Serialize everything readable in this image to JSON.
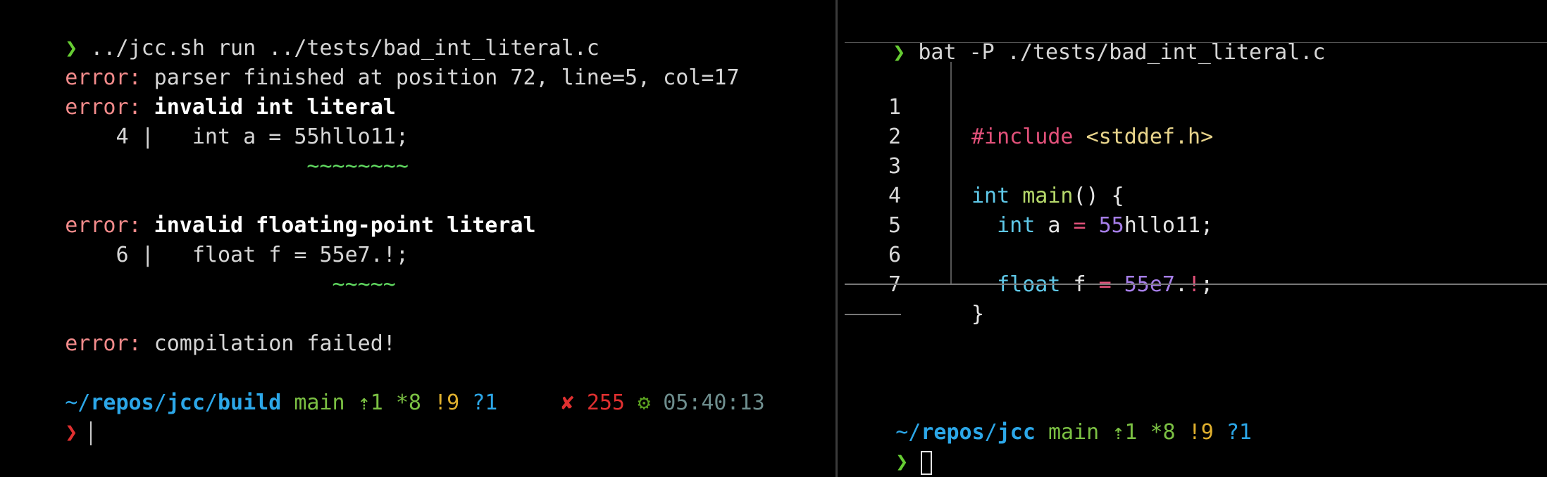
{
  "colors": {
    "background": "#000000",
    "error_label": "#f38b8b",
    "prompt_green": "#66cc33",
    "prompt_red": "#e03030",
    "path_blue": "#2ca7e8",
    "git_green": "#7bc043",
    "git_yellow": "#e0b02e",
    "squiggle_green": "#5fd75f"
  },
  "icons": {
    "prompt": "❯",
    "status_fail": "✘",
    "gear": "⚙"
  },
  "left": {
    "command_prompt": "❯",
    "command": " ../jcc.sh run ../tests/bad_int_literal.c",
    "err1_label": "error:",
    "err1_text": " parser finished at position 72, line=5, col=17",
    "err2_label": "error:",
    "err2_text": " invalid int literal",
    "err2_snippet": "    4 |   int a = 55hllo11;",
    "err2_squiggle": "                   ~~~~~~~~",
    "err3_label": "error:",
    "err3_text": " invalid floating-point literal",
    "err3_snippet": "    6 |   float f = 55e7.!;",
    "err3_squiggle": "                     ~~~~~",
    "err4_label": "error:",
    "err4_text": " compilation failed!",
    "prompt": {
      "tilde": "~",
      "sep1": "/",
      "seg1": "repos",
      "sep2": "/",
      "seg2": "jcc",
      "sep3": "/",
      "seg3": "build",
      "branch": "main",
      "ahead": "⇡1",
      "stash": "*8",
      "modified": "!9",
      "untracked": "?1",
      "status_icon": "✘",
      "exit_code": "255",
      "gear_icon": "⚙",
      "time": "05:40:13"
    },
    "input_prompt": "❯"
  },
  "right": {
    "command_prompt": "❯",
    "command": " bat -P ./tests/bad_int_literal.c",
    "code_lines": [
      {
        "num": "1"
      },
      {
        "num": "2"
      },
      {
        "num": "3"
      },
      {
        "num": "4"
      },
      {
        "num": "5"
      },
      {
        "num": "6"
      },
      {
        "num": "7"
      }
    ],
    "code": {
      "l1_preproc": "#include",
      "l1_space": " ",
      "l1_header": "<stddef.h>",
      "l3_type": "int",
      "l3_space": " ",
      "l3_fn": "main",
      "l3_rest": "() {",
      "l4_indent": "  ",
      "l4_type": "int",
      "l4_var": " a ",
      "l4_eq": "=",
      "l4_sp": " ",
      "l4_num": "55",
      "l4_rest": "hllo11;",
      "l6_indent": "  ",
      "l6_type": "float",
      "l6_var": " f ",
      "l6_eq": "=",
      "l6_sp": " ",
      "l6_num": "55e7",
      "l6_dot": ".",
      "l6_excl": "!",
      "l6_semi": ";",
      "l7_brace": "}"
    },
    "prompt": {
      "tilde": "~",
      "sep1": "/",
      "seg1": "repos",
      "sep2": "/",
      "seg2": "jcc",
      "branch": "main",
      "ahead": "⇡1",
      "stash": "*8",
      "modified": "!9",
      "untracked": "?1"
    },
    "input_prompt": "❯"
  }
}
